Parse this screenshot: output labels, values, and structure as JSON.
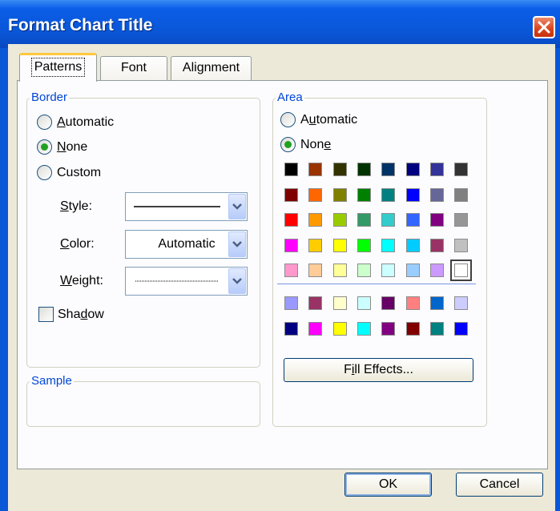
{
  "window": {
    "title": "Format Chart Title"
  },
  "tabs": [
    {
      "label": "Patterns"
    },
    {
      "label": "Font"
    },
    {
      "label": "Alignment"
    }
  ],
  "border": {
    "legend": "Border",
    "automatic": "Automatic",
    "none": "None",
    "custom": "Custom",
    "selected": "None",
    "style_label": "Style:",
    "color_label": "Color:",
    "color_value": "Automatic",
    "weight_label": "Weight:",
    "shadow_label": "Shadow",
    "shadow_checked": false
  },
  "sample": {
    "legend": "Sample"
  },
  "area": {
    "legend": "Area",
    "automatic": "Automatic",
    "none": "None",
    "selected": "None",
    "fill_effects": "Fill Effects...",
    "palette_rows": [
      [
        "#000000",
        "#993300",
        "#333300",
        "#003300",
        "#003366",
        "#000080",
        "#333399",
        "#333333"
      ],
      [
        "#800000",
        "#FF6600",
        "#808000",
        "#008000",
        "#008080",
        "#0000FF",
        "#666699",
        "#808080"
      ],
      [
        "#FF0000",
        "#FF9900",
        "#99CC00",
        "#339966",
        "#33CCCC",
        "#3366FF",
        "#800080",
        "#969696"
      ],
      [
        "#FF00FF",
        "#FFCC00",
        "#FFFF00",
        "#00FF00",
        "#00FFFF",
        "#00CCFF",
        "#993366",
        "#C0C0C0"
      ],
      [
        "#FF99CC",
        "#FFCC99",
        "#FFFF99",
        "#CCFFCC",
        "#CCFFFF",
        "#99CCFF",
        "#CC99FF",
        "#FFFFFF"
      ]
    ],
    "chart_rows": [
      [
        "#9999FF",
        "#993366",
        "#FFFFCC",
        "#CCFFFF",
        "#660066",
        "#FF8080",
        "#0066CC",
        "#CCCCFF"
      ],
      [
        "#000080",
        "#FF00FF",
        "#FFFF00",
        "#00FFFF",
        "#800080",
        "#800000",
        "#008080",
        "#0000FF"
      ]
    ]
  },
  "buttons": {
    "ok": "OK",
    "cancel": "Cancel"
  }
}
